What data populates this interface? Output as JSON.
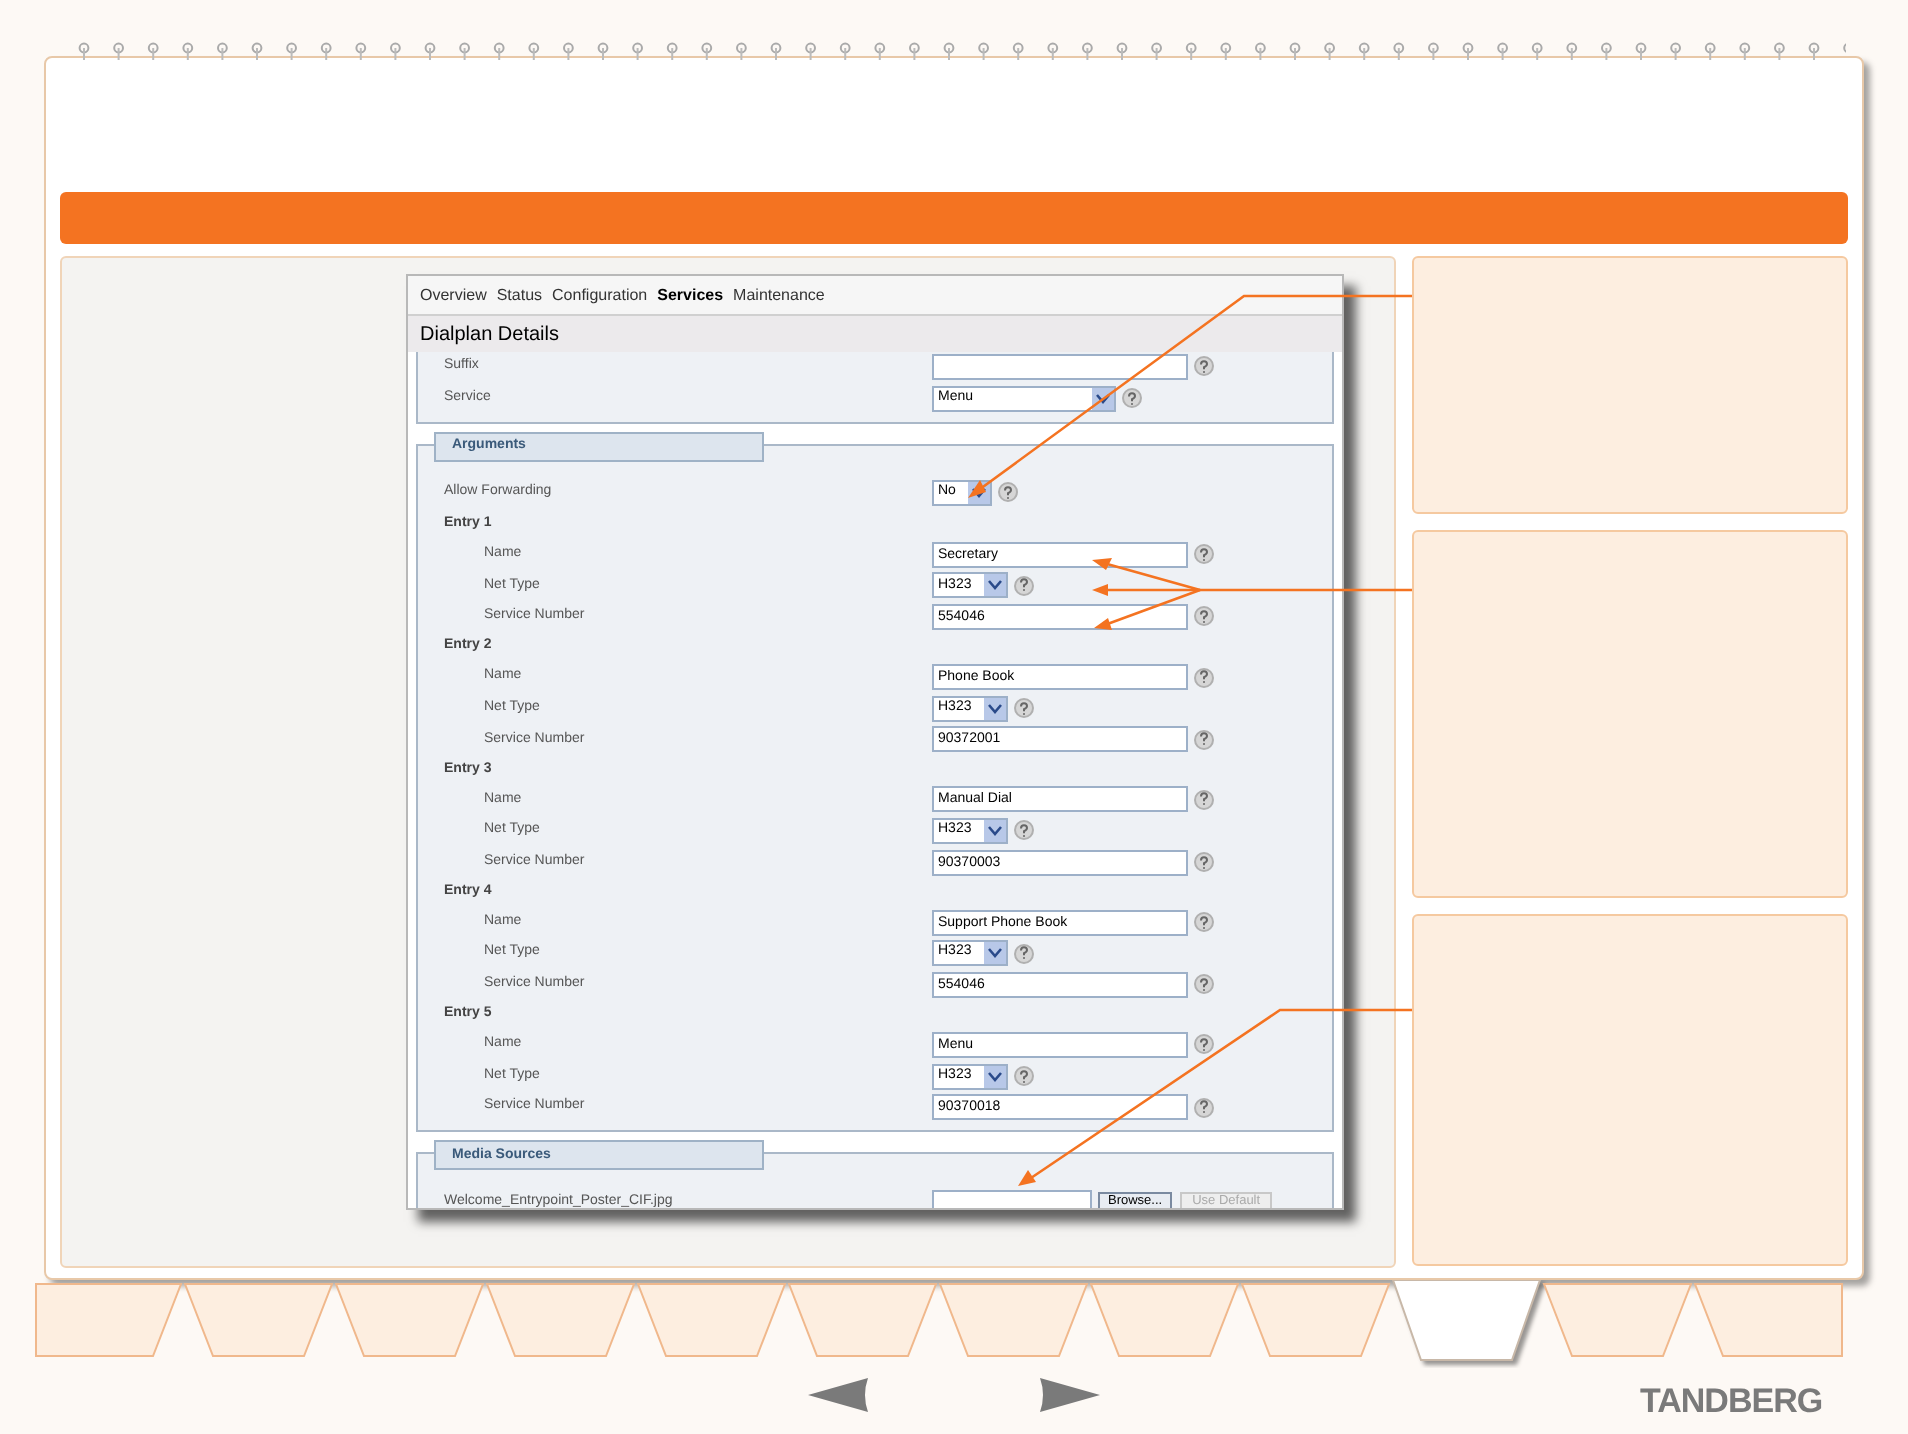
{
  "app_window": {
    "nav": [
      {
        "label": "Overview",
        "selected": false
      },
      {
        "label": "Status",
        "selected": false
      },
      {
        "label": "Configuration",
        "selected": false
      },
      {
        "label": "Services",
        "selected": true
      },
      {
        "label": "Maintenance",
        "selected": false
      }
    ],
    "title": "Dialplan Details",
    "top_fields": [
      {
        "kind": "input",
        "label": "Suffix"
      },
      {
        "kind": "select",
        "label": "Service",
        "value": "Menu"
      }
    ],
    "arguments": {
      "heading": "Arguments",
      "allow_forwarding": {
        "label": "Allow Forwarding",
        "value": "No"
      },
      "entries": [
        {
          "title": "Entry 1",
          "name_label": "Name",
          "name": "Secretary",
          "net_type_label": "Net Type",
          "net_type": "H323",
          "number_label": "Service Number",
          "number": "554046"
        },
        {
          "title": "Entry 2",
          "name_label": "Name",
          "name": "Phone Book",
          "net_type_label": "Net Type",
          "net_type": "H323",
          "number_label": "Service Number",
          "number": "90372001"
        },
        {
          "title": "Entry 3",
          "name_label": "Name",
          "name": "Manual Dial",
          "net_type_label": "Net Type",
          "net_type": "H323",
          "number_label": "Service Number",
          "number": "90370003"
        },
        {
          "title": "Entry 4",
          "name_label": "Name",
          "name": "Support Phone Book",
          "net_type_label": "Net Type",
          "net_type": "H323",
          "number_label": "Service Number",
          "number": "554046"
        },
        {
          "title": "Entry 5",
          "name_label": "Name",
          "name": "Menu",
          "net_type_label": "Net Type",
          "net_type": "H323",
          "number_label": "Service Number",
          "number": "90370018"
        }
      ]
    },
    "media_sources": {
      "heading": "Media Sources",
      "file_label": "Welcome_Entrypoint_Poster_CIF.jpg",
      "browse": "Browse...",
      "use_default": {
        "label": "Use Default",
        "disabled": true
      }
    }
  },
  "bottom_tabs": [
    {
      "selected": false
    },
    {
      "selected": false
    },
    {
      "selected": false
    },
    {
      "selected": false
    },
    {
      "selected": false
    },
    {
      "selected": false
    },
    {
      "selected": false
    },
    {
      "selected": false
    },
    {
      "selected": false
    },
    {
      "selected": true
    },
    {
      "selected": false
    },
    {
      "selected": false
    }
  ],
  "logo": "TANDBERG"
}
